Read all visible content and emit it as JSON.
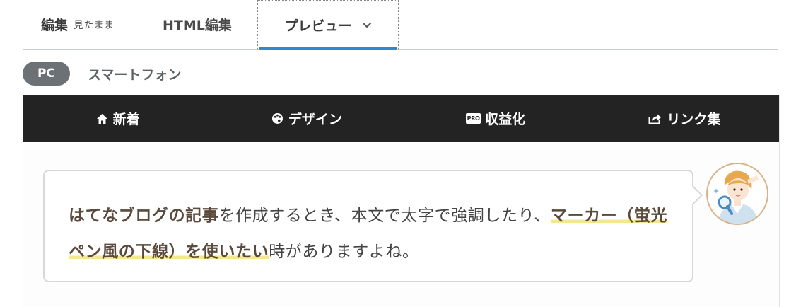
{
  "editor_tabs": {
    "edit_label": "編集",
    "edit_sub": "見たまま",
    "html_label": "HTML編集",
    "preview_label": "プレビュー"
  },
  "device_toggle": {
    "pc_label": "PC",
    "smartphone_label": "スマートフォン"
  },
  "site_nav": {
    "items": [
      {
        "label": "新着",
        "icon": "home-icon"
      },
      {
        "label": "デザイン",
        "icon": "palette-icon"
      },
      {
        "label": "収益化",
        "icon": "pro-badge-icon",
        "badge": "PRO"
      },
      {
        "label": "リンク集",
        "icon": "share-icon"
      }
    ]
  },
  "balloon": {
    "bold_intro": "はてなブログの記事",
    "text_1": "を作成するとき、本文で太字で強調したり、",
    "marker_text": "マーカー（蛍光ペン風の下線）を使いたい",
    "text_2": "時がありますよね。"
  },
  "colors": {
    "accent_tab": "#2b8ad8",
    "nav_bg": "#232323",
    "pill_bg": "#6b7174",
    "marker": "#f3e88f"
  }
}
